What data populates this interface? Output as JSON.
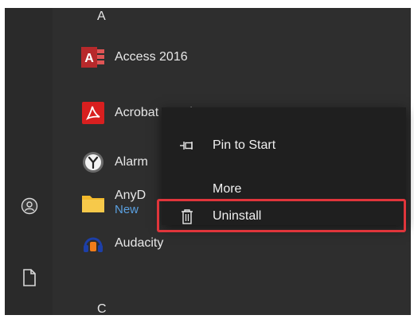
{
  "start_menu": {
    "section_letters": [
      "A",
      "C"
    ],
    "apps": [
      {
        "name": "Access 2016",
        "sub": "",
        "icon": "access-icon"
      },
      {
        "name": "Acrobat Reader DC",
        "sub": "",
        "icon": "acrobat-reader-icon"
      },
      {
        "name": "Alarm",
        "sub": "",
        "icon": "alarms-clock-icon"
      },
      {
        "name": "AnyD",
        "sub": "New",
        "icon": "folder-icon"
      },
      {
        "name": "Audacity",
        "sub": "",
        "icon": "audacity-icon"
      }
    ],
    "rail_icons": [
      "user-icon",
      "document-icon"
    ]
  },
  "context_menu": {
    "items": [
      {
        "label": "Pin to Start",
        "icon": "pin-icon"
      },
      {
        "label": "More",
        "icon": ""
      },
      {
        "label": "Uninstall",
        "icon": "trash-icon"
      }
    ],
    "highlighted_item": "Uninstall",
    "highlight_color": "#e0353b"
  }
}
